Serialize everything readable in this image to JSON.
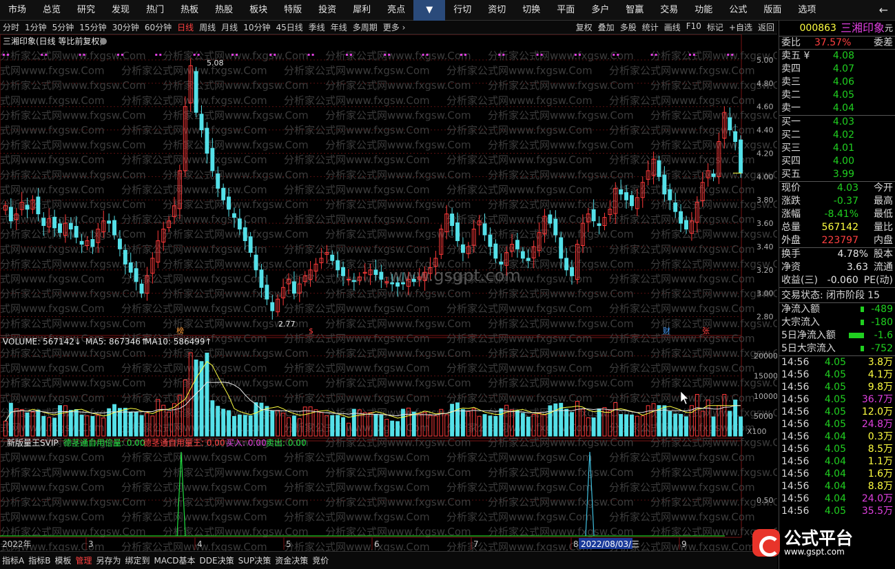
{
  "top_menu": [
    "市场",
    "总览",
    "研究",
    "发现",
    "热门",
    "热板",
    "热股",
    "板块",
    "特版",
    "投资",
    "犀利",
    "亮点",
    "▼",
    "行切",
    "资切",
    "切换",
    "平面",
    "多户",
    "智赢",
    "交易",
    "功能",
    "公式",
    "版面",
    "选项"
  ],
  "back_icon": "←",
  "period_bar": {
    "items": [
      "分时",
      "1分钟",
      "5分钟",
      "15分钟",
      "30分钟",
      "60分钟",
      "日线",
      "周线",
      "月线",
      "10分钟",
      "45日线",
      "季线",
      "年线",
      "多周期",
      "更多 ›"
    ],
    "active": "日线",
    "tools": [
      "复权",
      "叠加",
      "多股",
      "统计",
      "画线",
      "F10",
      "标记",
      "+自选",
      "返回"
    ]
  },
  "chart_title": "三湘印象(日线 等比前复权)",
  "watermark": "分析家公式网www.fxgsw.Com",
  "center_watermark": "www.gsgpt.com",
  "volume_legend": {
    "vol": "VOLUME: 567142↓",
    "ma5": "MA5: 867346↑",
    "ma10": "MA10: 586499↑"
  },
  "indicator_legend": {
    "name": "新版量王SVIP",
    "a": "德茎通自用倍量: 0.00",
    "b": "德茎通自用量王: 0.00",
    "c": "买入: 0.00",
    "d": "卖出: 0.00"
  },
  "markers": {
    "high": "5.08",
    "low": "2.77",
    "m1": "榜",
    "m2": "$",
    "m3": "财",
    "m4": "张"
  },
  "x_axis": {
    "year": "2022年",
    "months": [
      "3",
      "4",
      "5",
      "6",
      "7",
      "8",
      "9"
    ],
    "cursor_date": "2022/08/03/三",
    "x100": "X100"
  },
  "bottom_tabs": [
    "指标A",
    "指标B",
    "模板",
    "管理",
    "另存为",
    "绑定到",
    "MACD基本",
    "DDE决策",
    "SUP决策",
    "资金决策",
    "竞价"
  ],
  "bottom_active": "管理",
  "colors": {
    "up": "#ff3a3a",
    "down": "#54e0e8",
    "grid": "#5a1010"
  },
  "chart_data": [
    {
      "type": "candlestick",
      "title": "三湘印象(日线 等比前复权)",
      "ylim": [
        2.65,
        5.1
      ],
      "y_ticks": [
        "5.00",
        "4.80",
        "4.60",
        "4.40",
        "4.20",
        "4.00",
        "3.80",
        "3.60",
        "3.40",
        "3.20",
        "3.00",
        "2.80"
      ],
      "high": 5.08,
      "low": 2.77,
      "close": [
        3.75,
        3.62,
        3.68,
        3.78,
        3.72,
        3.8,
        3.68,
        3.58,
        3.64,
        3.56,
        3.52,
        3.6,
        3.55,
        3.48,
        3.42,
        3.45,
        3.4,
        3.55,
        3.62,
        3.6,
        3.5,
        3.38,
        3.25,
        3.18,
        3.1,
        3.0,
        3.15,
        3.3,
        3.45,
        3.55,
        3.62,
        3.75,
        4.05,
        4.6,
        4.95,
        4.55,
        4.4,
        4.2,
        4.05,
        3.9,
        3.8,
        3.72,
        3.65,
        3.55,
        3.45,
        3.35,
        3.2,
        3.05,
        2.95,
        2.85,
        2.95,
        3.05,
        3.12,
        3.0,
        3.08,
        3.15,
        3.2,
        3.25,
        3.3,
        3.35,
        3.28,
        3.2,
        3.15,
        3.12,
        3.1,
        3.14,
        3.18,
        3.2,
        3.16,
        3.12,
        3.1,
        3.08,
        3.06,
        3.08,
        3.12,
        3.1,
        3.14,
        3.18,
        3.22,
        3.3,
        3.55,
        3.68,
        3.58,
        3.45,
        3.35,
        3.4,
        3.55,
        3.62,
        3.5,
        3.4,
        3.3,
        3.25,
        3.35,
        3.42,
        3.38,
        3.3,
        3.28,
        3.4,
        3.52,
        3.66,
        3.6,
        3.5,
        3.3,
        3.2,
        3.15,
        3.42,
        3.6,
        3.68,
        3.62,
        3.58,
        3.65,
        3.72,
        3.9,
        3.85,
        3.8,
        3.75,
        3.82,
        3.95,
        4.05,
        4.15,
        4.0,
        3.85,
        3.8,
        3.7,
        3.6,
        3.55,
        3.62,
        3.78,
        3.95,
        4.05,
        4.0,
        4.3,
        4.55,
        4.4,
        4.3,
        4.03
      ],
      "volume_ylim": [
        0,
        22000
      ],
      "volume_ticks": [
        "20000",
        "15000",
        "10000",
        "5000"
      ],
      "indicator_ticks": [
        "0.50"
      ]
    }
  ],
  "right_panel": {
    "code": "000863",
    "name": "三湘印象",
    "yuan": "元",
    "weibi_label": "委比",
    "weibi_value": "37.57%",
    "weicha_label": "委差",
    "sell": [
      {
        "label": "卖五 ¥",
        "price": "4.08"
      },
      {
        "label": "卖四",
        "price": "4.07"
      },
      {
        "label": "卖三",
        "price": "4.06"
      },
      {
        "label": "卖二",
        "price": "4.05"
      },
      {
        "label": "卖一",
        "price": "4.04"
      }
    ],
    "buy": [
      {
        "label": "买一",
        "price": "4.03"
      },
      {
        "label": "买二",
        "price": "4.02"
      },
      {
        "label": "买三",
        "price": "4.01"
      },
      {
        "label": "买四",
        "price": "4.00"
      },
      {
        "label": "买五",
        "price": "3.99"
      }
    ],
    "quote": [
      {
        "l": "现价",
        "v": "4.03",
        "c": "grn",
        "r": "今开"
      },
      {
        "l": "涨跌",
        "v": "-0.37",
        "c": "grn",
        "r": "最高"
      },
      {
        "l": "涨幅",
        "v": "-8.41%",
        "c": "grn",
        "r": "最低"
      },
      {
        "l": "总量",
        "v": "567142",
        "c": "yel",
        "r": "量比"
      },
      {
        "l": "外盘",
        "v": "223797",
        "c": "red",
        "r": "内盘"
      }
    ],
    "stats": [
      {
        "l": "换手",
        "v": "4.78%",
        "r": "股本"
      },
      {
        "l": "净资",
        "v": "3.63",
        "r": "流通"
      },
      {
        "l": "收益(三)",
        "v": "-0.060",
        "r": "PE(动)"
      }
    ],
    "trade_state": "交易状态: 闭市阶段",
    "trade_state_num": "15",
    "flows": [
      {
        "l": "净流入额",
        "v": "-489",
        "bar": "small"
      },
      {
        "l": "大宗流入",
        "v": "-180",
        "bar": "small"
      },
      {
        "l": "5日净流入额",
        "v": "-1.6",
        "bar": "big"
      },
      {
        "l": "5日大宗流入",
        "v": "-752",
        "bar": "small"
      }
    ],
    "ticks": [
      {
        "t": "14:56",
        "p": "4.05",
        "v": "3.8万",
        "c": "yel"
      },
      {
        "t": "14:56",
        "p": "4.05",
        "v": "4.1万",
        "c": "yel"
      },
      {
        "t": "14:56",
        "p": "4.05",
        "v": "9.8万",
        "c": "yel"
      },
      {
        "t": "14:56",
        "p": "4.05",
        "v": "36.7万",
        "c": "mag"
      },
      {
        "t": "14:56",
        "p": "4.05",
        "v": "12.0万",
        "c": "yel"
      },
      {
        "t": "14:56",
        "p": "4.05",
        "v": "24.8万",
        "c": "mag"
      },
      {
        "t": "14:56",
        "p": "4.04",
        "v": "0.3万",
        "c": "yel"
      },
      {
        "t": "14:56",
        "p": "4.05",
        "v": "8.5万",
        "c": "yel"
      },
      {
        "t": "14:56",
        "p": "4.04",
        "v": "1.1万",
        "c": "yel"
      },
      {
        "t": "14:56",
        "p": "4.04",
        "v": "1.6万",
        "c": "yel"
      },
      {
        "t": "14:56",
        "p": "4.04",
        "v": "8.8万",
        "c": "yel"
      },
      {
        "t": "14:56",
        "p": "4.04",
        "v": "24.0万",
        "c": "mag"
      },
      {
        "t": "14:56",
        "p": "4.05",
        "v": "35.5万",
        "c": "mag"
      }
    ]
  },
  "logo": {
    "name": "公式平台",
    "url": "www.gspt.com"
  }
}
